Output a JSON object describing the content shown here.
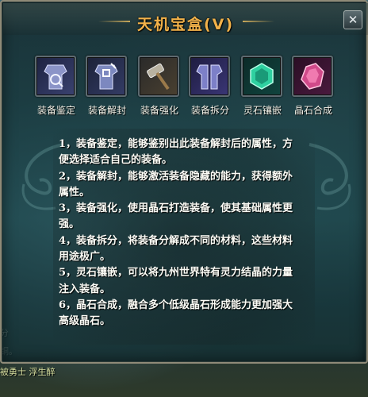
{
  "window": {
    "title": "天机宝盒(V)",
    "close_glyph": "✕"
  },
  "tools": [
    {
      "label": "装备鉴定",
      "icon": "armor-identify-icon",
      "color": "#7a86b8"
    },
    {
      "label": "装备解封",
      "icon": "armor-unseal-icon",
      "color": "#6c7db0"
    },
    {
      "label": "装备强化",
      "icon": "hammer-icon",
      "color": "#8a7a60"
    },
    {
      "label": "装备拆分",
      "icon": "armor-split-icon",
      "color": "#6c6fb0"
    },
    {
      "label": "灵石镶嵌",
      "icon": "green-gem-icon",
      "color": "#2fd0a0"
    },
    {
      "label": "晶石合成",
      "icon": "red-crystal-icon",
      "color": "#d04a8a"
    }
  ],
  "description": [
    "1，装备鉴定，能够鉴别出此装备解封后的属性，方便选择适合自己的装备。",
    "2，装备解封，能够激活装备隐藏的能力，获得额外属性。",
    "3，装备强化，使用晶石打造装备，使其基础属性更强。",
    "4，装备拆分，将装备分解成不同的材料，这些材料用途极广。",
    "5，灵石镶嵌，可以将九州世界特有灵力结晶的力量注入装备。",
    "6，晶石合成，融合多个低级晶石形成能力更加强大高级晶石。"
  ],
  "background_chat": [
    {
      "text": "分"
    },
    {
      "text": "铜。"
    },
    {
      "text": "被勇士 浮生醉"
    }
  ]
}
